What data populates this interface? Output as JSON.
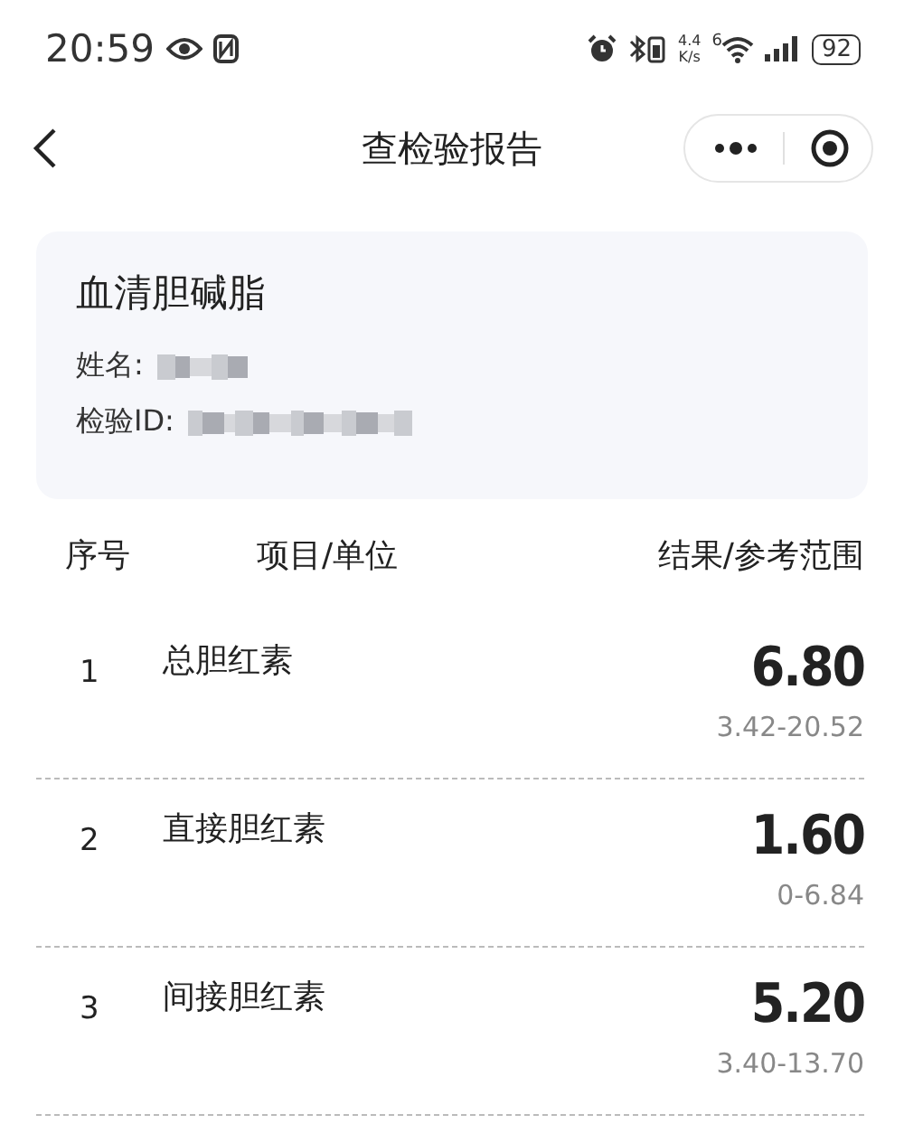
{
  "status_bar": {
    "time": "20:59",
    "speed_value": "4.4",
    "speed_unit": "K/s",
    "network": "6",
    "battery": "92"
  },
  "nav": {
    "title": "查检验报告"
  },
  "card": {
    "title": "血清胆碱脂",
    "fields": [
      {
        "label": "姓名:"
      },
      {
        "label": "检验ID:"
      }
    ]
  },
  "table": {
    "columns": [
      "序号",
      "项目/单位",
      "结果/参考范围"
    ],
    "rows": [
      {
        "index": "1",
        "item": "总胆红素",
        "result": "6.80",
        "range": "3.42-20.52"
      },
      {
        "index": "2",
        "item": "直接胆红素",
        "result": "1.60",
        "range": "0-6.84"
      },
      {
        "index": "3",
        "item": "间接胆红素",
        "result": "5.20",
        "range": "3.40-13.70"
      }
    ]
  }
}
